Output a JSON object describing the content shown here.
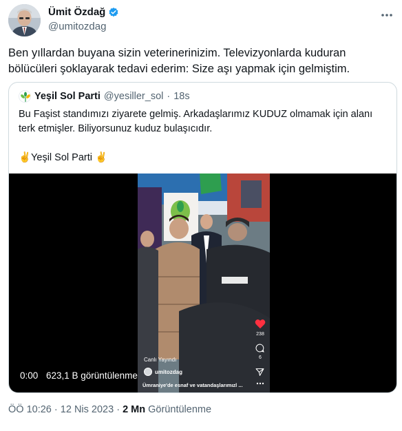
{
  "author": {
    "name": "Ümit Özdağ",
    "handle": "@umitozdag",
    "verified": true
  },
  "tweet": {
    "text": "Ben yıllardan buyana sizin veterinerinizim. Televizyonlarda kuduran\nbölücüleri şoklayarak tedavi ederim: Size aşı yapmak için gelmiştim."
  },
  "quoted": {
    "name": "Yeşil Sol Parti",
    "handle": "@yesiller_sol",
    "separator": "·",
    "time": "18s",
    "text": "Bu Faşist standımızı ziyarete gelmiş. Arkadaşlarımız KUDUZ olmamak için alanı\nterk etmişler. Biliyorsunuz kuduz bulaşıcıdır.\n\n✌️Yeşil Sol Parti ✌️"
  },
  "video": {
    "time": "0:00",
    "views": "623,1 B görüntülenme",
    "overlay": {
      "likes": "238",
      "comments": "6",
      "live_label": "Canlı Yayındı",
      "username": "umitozdag",
      "caption": "Ümraniye'de esnaf ve vatandaşlarımızl ..."
    }
  },
  "meta": {
    "time": "ÖÖ 10:26",
    "separator1": "·",
    "date": "12 Nis 2023",
    "separator2": "·",
    "views": "2 Mn",
    "views_label": "Görüntülenme"
  },
  "colors": {
    "verified": "#1d9bf0",
    "secondary_text": "#536471",
    "border": "#cfd9de"
  }
}
